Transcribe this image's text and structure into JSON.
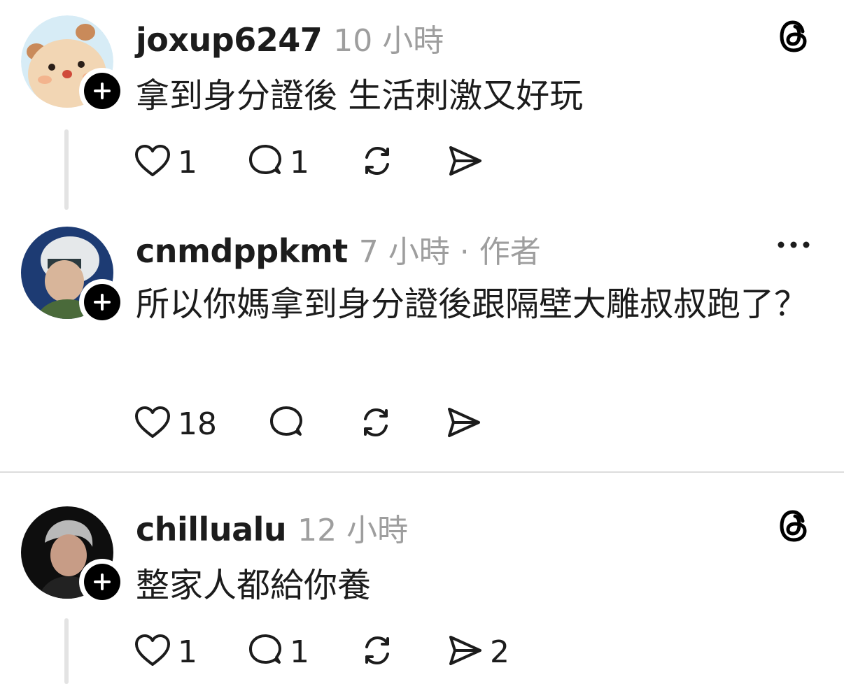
{
  "posts": [
    {
      "username": "joxup6247",
      "meta": "10 小時",
      "text": "拿到身分證後 生活刺激又好玩",
      "corner_icon": "threads-icon",
      "likes": "1",
      "replies": "1",
      "shares": ""
    },
    {
      "username": "cnmdppkmt",
      "meta": "7 小時 · 作者",
      "text": "所以你媽拿到身分證後跟隔壁大雕叔叔跑了？",
      "corner_icon": "more-icon",
      "likes": "18",
      "replies": "",
      "shares": ""
    },
    {
      "username": "chillualu",
      "meta": "12 小時",
      "text": "整家人都給你養",
      "corner_icon": "threads-icon",
      "likes": "1",
      "replies": "1",
      "shares": "2"
    }
  ],
  "colors": {
    "text": "#1c1c1c",
    "meta": "#9e9e9e",
    "badge": "#000000",
    "divider": "#dddddd",
    "thread_line": "#e3e3e3"
  },
  "icons": [
    "heart-icon",
    "comment-icon",
    "repost-icon",
    "send-icon",
    "threads-icon",
    "more-icon",
    "plus-icon"
  ]
}
